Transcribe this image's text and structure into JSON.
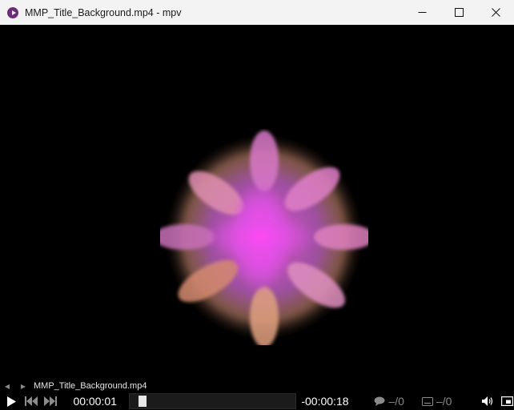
{
  "window": {
    "title": "MMP_Title_Background.mp4 - mpv",
    "icon": "mpv-app-icon",
    "controls": [
      "minimize-icon",
      "maximize-icon",
      "close-icon"
    ]
  },
  "playlist": {
    "current_file": "MMP_Title_Background.mp4",
    "prev_icon": "triangle-left-icon",
    "next_icon": "triangle-right-icon"
  },
  "controls": {
    "play_icon": "play-icon",
    "prev_icon": "skip-previous-icon",
    "next_icon": "skip-next-icon",
    "elapsed": "00:00:01",
    "remaining": "-00:00:18",
    "progress": 0.05,
    "audio_track": "–/0",
    "subtitle_track": "–/0",
    "volume_icon": "speaker-icon",
    "fullscreen_icon": "fullscreen-icon"
  },
  "colors": {
    "titlebar_bg": "#f3f3f3",
    "video_bg": "#000000",
    "burst_core": "#ff44f0",
    "burst_mid": "#d060e0",
    "burst_outer": "#f0a070"
  }
}
